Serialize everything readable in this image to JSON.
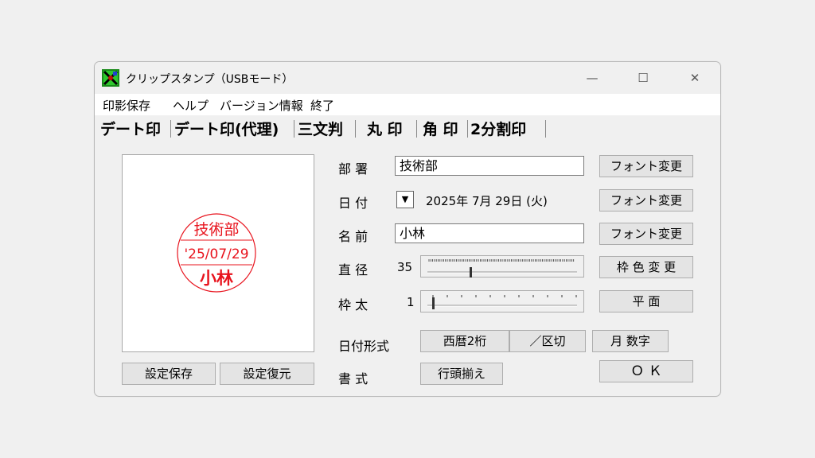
{
  "window": {
    "title": "クリップスタンプ（USBモード）",
    "controls": {
      "minimize": "—",
      "maximize": "☐",
      "close": "✕"
    }
  },
  "menu": [
    "印影保存",
    "ヘルプ",
    "バージョン情報",
    "終了"
  ],
  "tabs": [
    "デート印",
    "デート印(代理)",
    "三文判",
    "丸 印",
    "角 印",
    "2分割印"
  ],
  "stamp_preview": {
    "top_text": "技術部",
    "date_text": "'25/07/29",
    "bottom_text": "小林",
    "color": "#e8141e"
  },
  "preview_buttons": {
    "save": "設定保存",
    "restore": "設定復元"
  },
  "fields": {
    "department": {
      "label": "部 署",
      "value": "技術部",
      "font_button": "フォント変更"
    },
    "date": {
      "label": "日 付",
      "dropdown_icon": "▼",
      "value": "2025年  7月 29日 (火)",
      "font_button": "フォント変更"
    },
    "name": {
      "label": "名 前",
      "value": "小林",
      "font_button": "フォント変更"
    },
    "diameter": {
      "label": "直 径",
      "value": "35",
      "button": "枠 色 変 更"
    },
    "frame_width": {
      "label": "枠 太",
      "value": "1",
      "button": "平  面"
    }
  },
  "date_format": {
    "label": "日付形式",
    "options": [
      "西暦2桁",
      "／区切",
      "月 数字"
    ]
  },
  "style": {
    "label": "書 式",
    "button": "行頭揃え"
  },
  "ok_button": "Ｏ Ｋ"
}
